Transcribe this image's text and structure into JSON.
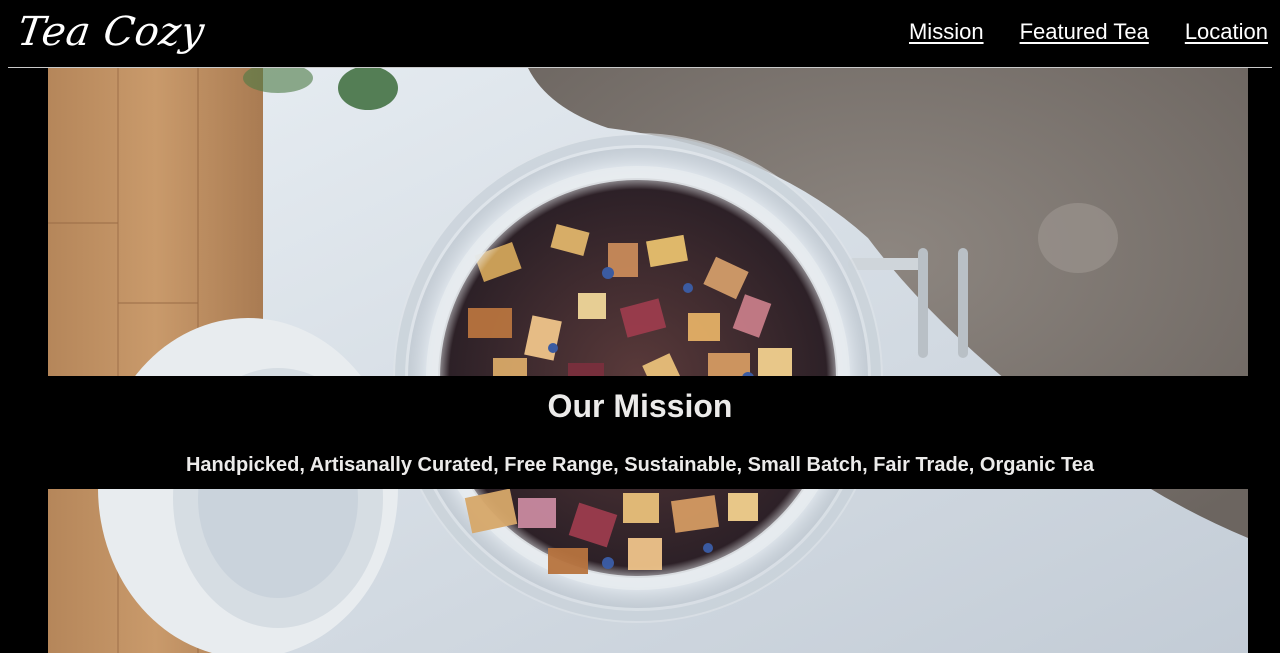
{
  "header": {
    "logo_text": "Tea Cozy",
    "nav": [
      {
        "label": "Mission"
      },
      {
        "label": "Featured Tea"
      },
      {
        "label": "Location"
      }
    ]
  },
  "hero": {
    "image_subject": "loose-leaf-tea-jar"
  },
  "mission": {
    "title": "Our Mission",
    "subtitle": "Handpicked, Artisanally Curated, Free Range, Sustainable, Small Batch, Fair Trade, Organic Tea"
  },
  "colors": {
    "background": "#000000",
    "text": "#ffffff",
    "mission_text": "#ecebea",
    "header_rule": "#c9c9c9"
  }
}
